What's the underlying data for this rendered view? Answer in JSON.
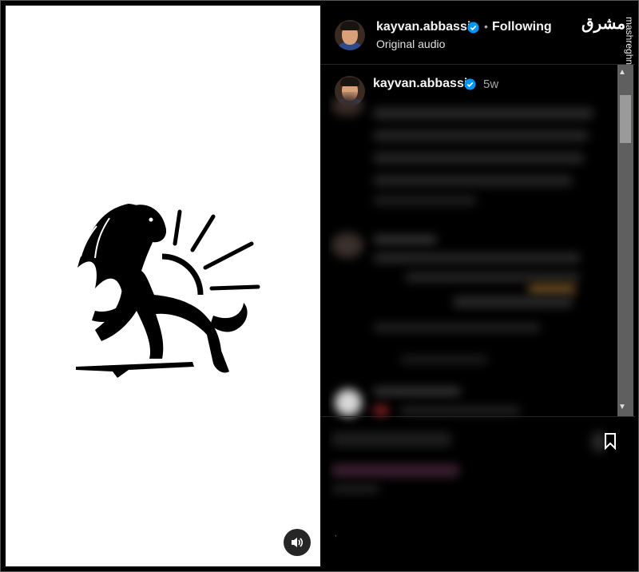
{
  "header": {
    "username": "kayvan.abbassi",
    "separator": "•",
    "follow_label": "Following",
    "audio_label": "Original audio",
    "verified_icon": "verified-badge-icon"
  },
  "post": {
    "username": "kayvan.abbassi",
    "time": "5w"
  },
  "watermark": {
    "logo": "مشرق",
    "url": "mashreghnews.ir"
  },
  "media": {
    "image": "lion-and-sun-emblem",
    "sound_icon": "speaker-icon"
  },
  "scrollbar": {
    "up_arrow": "▲",
    "down_arrow": "▼"
  },
  "colors": {
    "verified": "#0095f6",
    "panel_bg": "#000000",
    "media_bg": "#ffffff"
  }
}
